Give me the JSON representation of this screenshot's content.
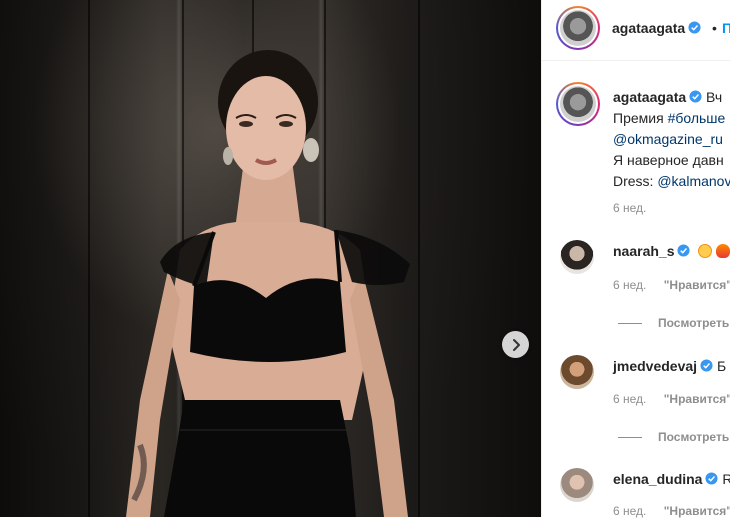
{
  "post": {
    "next_label": "›",
    "author": "agataagata",
    "dot": "•",
    "follow_label": "П",
    "caption_head": "Вч",
    "caption_line1_prefix": "Премия ",
    "caption_line1_tag": "#больше",
    "caption_line2_link": "@okmagazine_ru",
    "caption_line3": "Я наверное давн",
    "caption_line4_prefix": "Dress: ",
    "caption_line4_link": "@kalmanov",
    "time": "6 нед."
  },
  "comments": [
    {
      "user": "naarah_s",
      "text": "",
      "time": "6 нед.",
      "like_label": "\"Нравится\":",
      "replies": "Посмотреть"
    },
    {
      "user": "jmedvedevaj",
      "text": "Б",
      "time": "6 нед.",
      "like_label": "\"Нравится\":",
      "replies": "Посмотреть"
    },
    {
      "user": "elena_dudina",
      "text": "R",
      "time": "6 нед.",
      "like_label": "\"Нравится\":"
    }
  ],
  "colors": {
    "link": "#00376b",
    "follow": "#0095f6",
    "verified": "#3897f0",
    "meta": "#8e8e8e"
  }
}
